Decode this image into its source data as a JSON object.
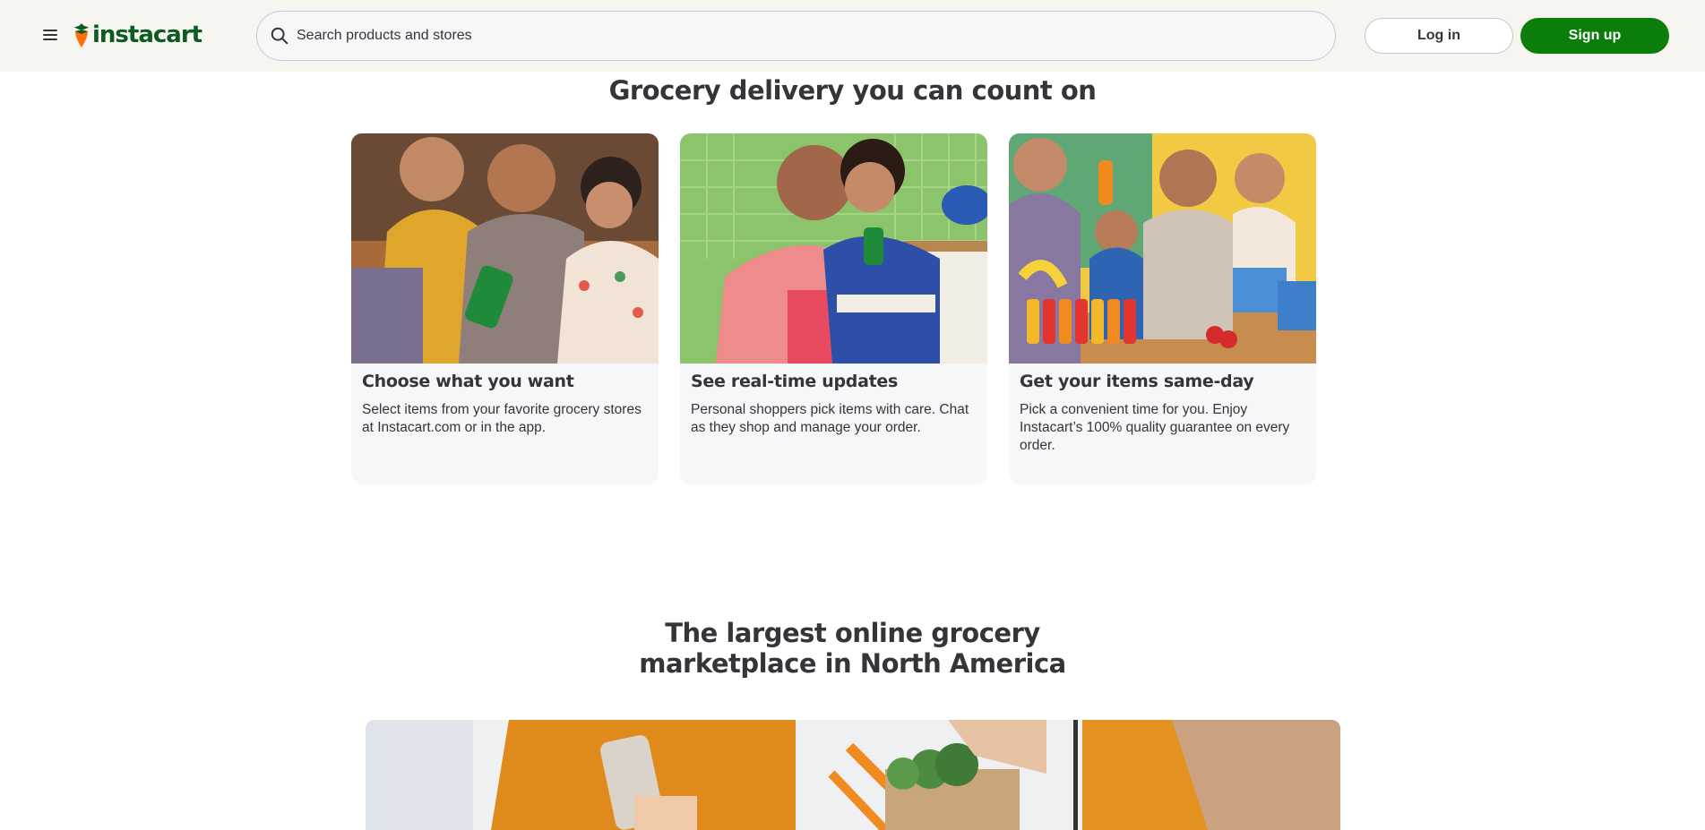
{
  "header": {
    "logo_text": "instacart",
    "search_placeholder": "Search products and stores",
    "login_label": "Log in",
    "signup_label": "Sign up"
  },
  "colors": {
    "brand_green": "#0a7d0a",
    "logo_green": "#0c5c22",
    "carrot_orange": "#ff7009",
    "header_bg": "#f7f5f0",
    "card_bg": "#f6f7f8",
    "text": "#343538"
  },
  "icons": {
    "menu": "hamburger-menu-icon",
    "logo": "carrot-logo-icon",
    "search": "search-icon"
  },
  "section1": {
    "title": "Grocery delivery you can count on",
    "cards": [
      {
        "title": "Choose what you want",
        "description": "Select items from your favorite grocery stores at Instacart.com or in the app."
      },
      {
        "title": "See real-time updates",
        "description": "Personal shoppers pick items with care. Chat as they shop and manage your order."
      },
      {
        "title": "Get your items same-day",
        "description": "Pick a convenient time for you. Enjoy Instacart’s 100% quality guarantee on every order."
      }
    ]
  },
  "section2": {
    "title_line1": "The largest online grocery",
    "title_line2": "marketplace in North America"
  }
}
